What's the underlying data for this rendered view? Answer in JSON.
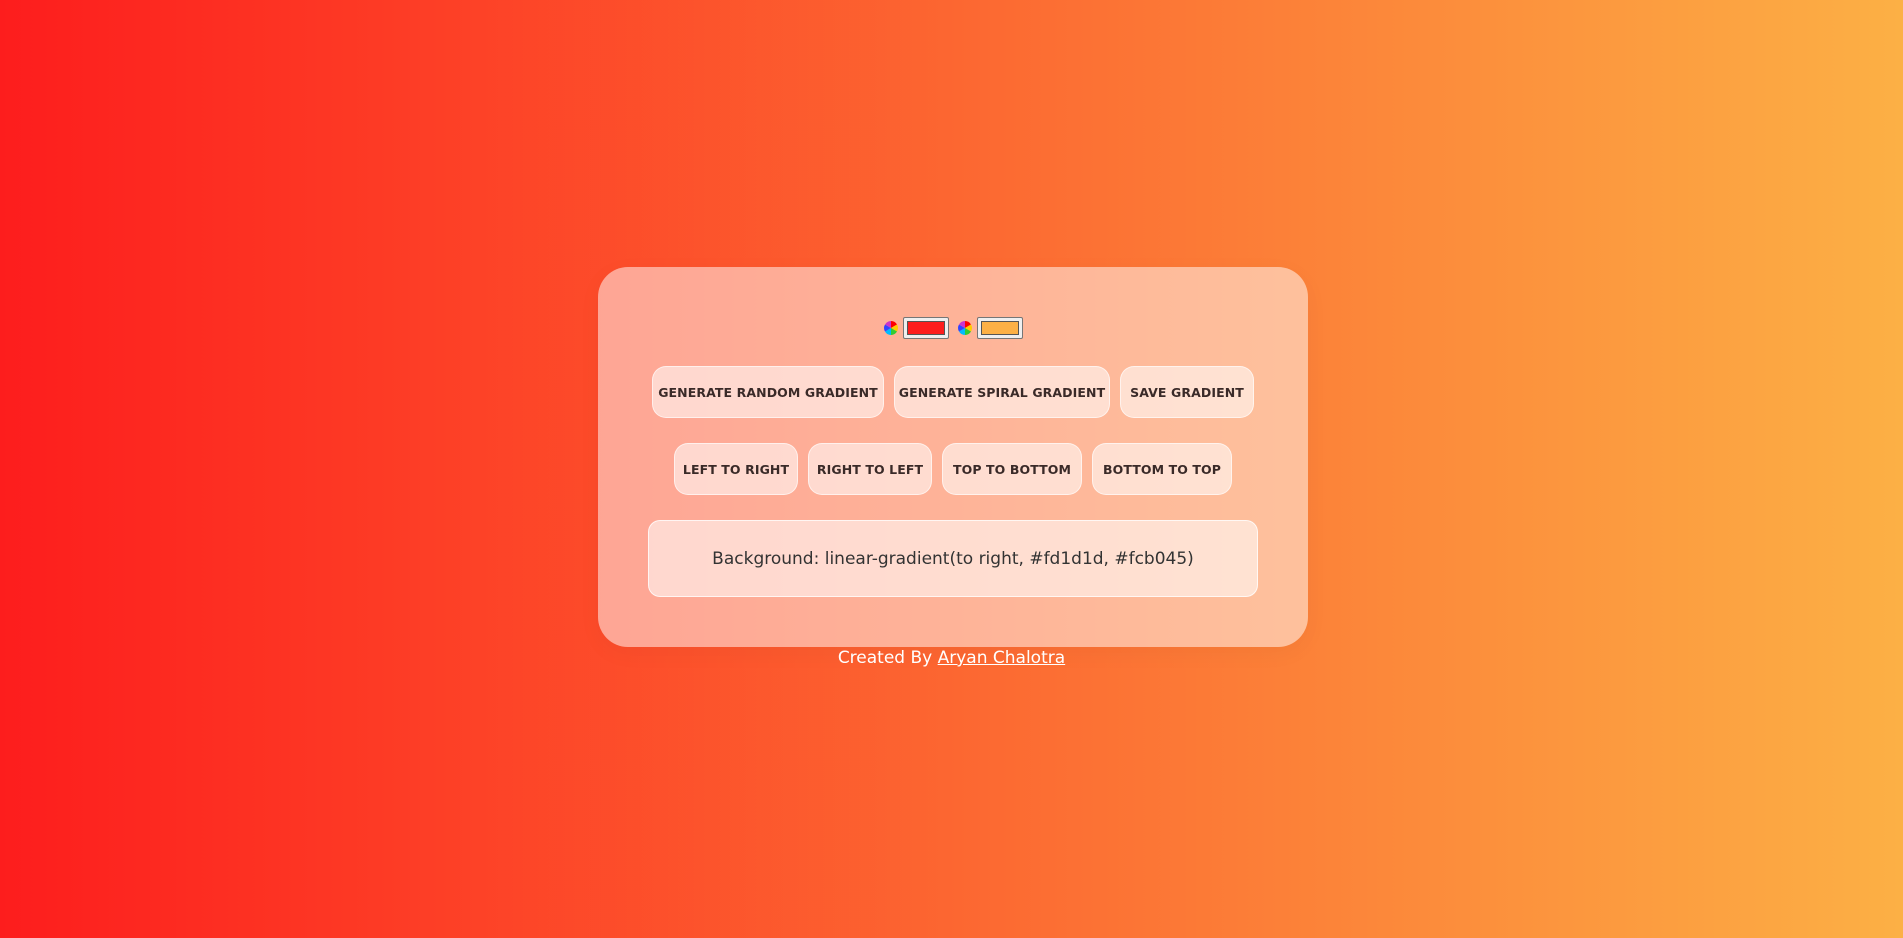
{
  "colors": {
    "start": "#fd1d1d",
    "end": "#fcb045"
  },
  "pickers": [
    {
      "icon": "color-wheel-icon",
      "value": "#fd1d1d"
    },
    {
      "icon": "color-wheel-icon",
      "value": "#fcb045"
    }
  ],
  "buttons": {
    "random": "GENERATE RANDOM GRADIENT",
    "spiral": "GENERATE SPIRAL GRADIENT",
    "save": "SAVE GRADIENT",
    "left_to_right": "LEFT TO RIGHT",
    "right_to_left": "RIGHT TO LEFT",
    "top_to_bottom": "TOP TO BOTTOM",
    "bottom_to_top": "BOTTOM TO TOP"
  },
  "output": {
    "text": "Background: linear-gradient(to right, #fd1d1d, #fcb045)"
  },
  "footer": {
    "prefix": "Created By ",
    "author": "Aryan Chalotra"
  }
}
